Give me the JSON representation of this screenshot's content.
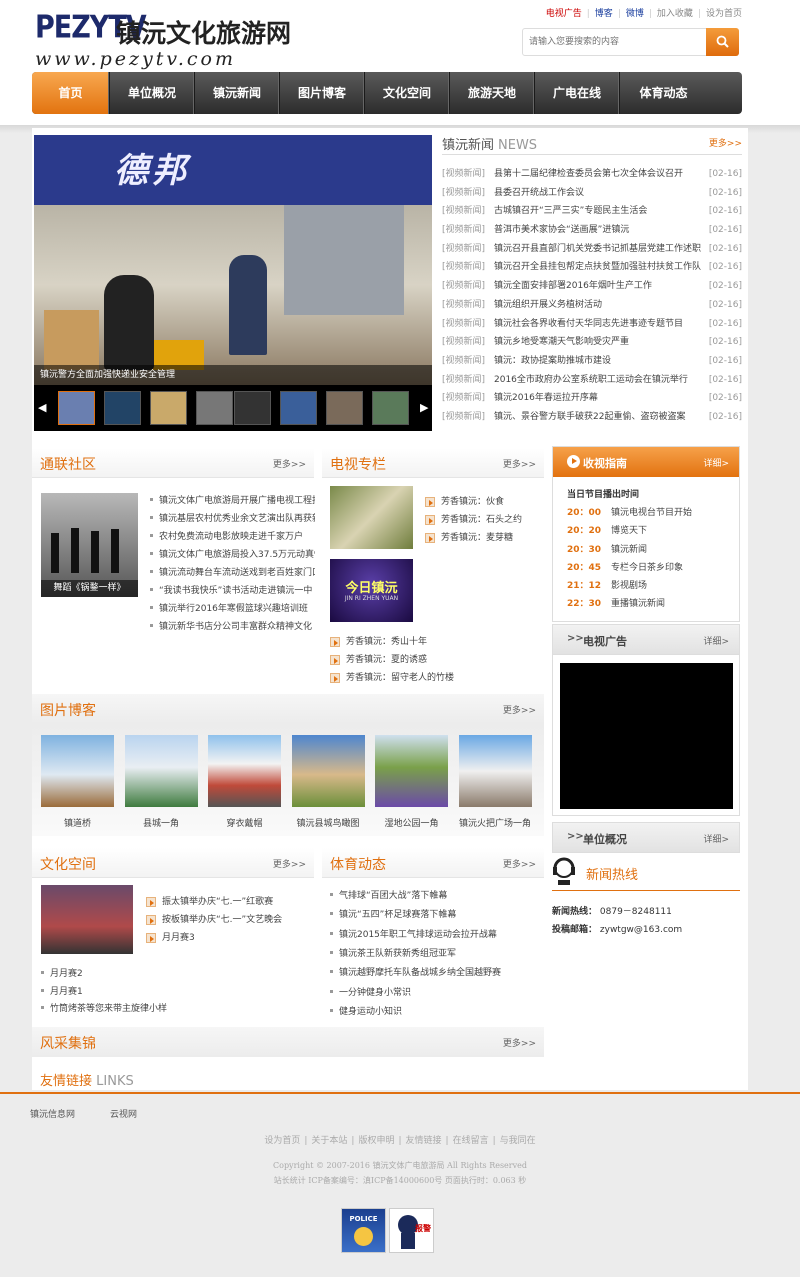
{
  "header": {
    "logo_en": "PEZYTV",
    "logo_cn": "镇沅文化旅游网",
    "logo_url": "www.pezytv.com",
    "links": [
      "电视广告",
      "博客",
      "微博",
      "加入收藏",
      "设为首页"
    ],
    "search_placeholder": "请输入您要搜索的内容"
  },
  "nav": [
    "首页",
    "单位概况",
    "镇沅新闻",
    "图片博客",
    "文化空间",
    "旅游天地",
    "广电在线",
    "体育动态"
  ],
  "slider": {
    "sign_text": "德邦",
    "caption": "镇沅警方全面加强快递业安全管理"
  },
  "news": {
    "title": "镇沅新闻",
    "title_en": "NEWS",
    "more": "更多>>",
    "items": [
      {
        "tag": "[视频新闻]",
        "text": "县第十二届纪律检查委员会第七次全体会议召开",
        "date": "[02-16]"
      },
      {
        "tag": "[视频新闻]",
        "text": "县委召开统战工作会议",
        "date": "[02-16]"
      },
      {
        "tag": "[视频新闻]",
        "text": "古城镇召开“三严三实”专题民主生活会",
        "date": "[02-16]"
      },
      {
        "tag": "[视频新闻]",
        "text": "普洱市美术家协会“送画展”进镇沅",
        "date": "[02-16]"
      },
      {
        "tag": "[视频新闻]",
        "text": "镇沅召开县直部门机关党委书记抓基层党建工作述职",
        "date": "[02-16]"
      },
      {
        "tag": "[视频新闻]",
        "text": "镇沅召开全县挂包帮定点扶贫暨加强驻村扶贫工作队",
        "date": "[02-16]"
      },
      {
        "tag": "[视频新闻]",
        "text": "镇沅全面安排部署2016年烟叶生产工作",
        "date": "[02-16]"
      },
      {
        "tag": "[视频新闻]",
        "text": "镇沅组织开展义务植树活动",
        "date": "[02-16]"
      },
      {
        "tag": "[视频新闻]",
        "text": "镇沅社会各界收看付天华同志先进事迹专题节目",
        "date": "[02-16]"
      },
      {
        "tag": "[视频新闻]",
        "text": "镇沅乡地受寒潮天气影响受灾严重",
        "date": "[02-16]"
      },
      {
        "tag": "[视频新闻]",
        "text": "镇沅：政协提案助推城市建设",
        "date": "[02-16]"
      },
      {
        "tag": "[视频新闻]",
        "text": "2016全市政府办公室系统职工运动会在镇沅举行",
        "date": "[02-16]"
      },
      {
        "tag": "[视频新闻]",
        "text": "镇沅2016年春运拉开序幕",
        "date": "[02-16]"
      },
      {
        "tag": "[视频新闻]",
        "text": "镇沅、景谷警方联手破获22起重偷、盗窃被盗案",
        "date": "[02-16]"
      }
    ]
  },
  "tonglian": {
    "title": "通联社区",
    "more": "更多>>",
    "img_caption": "舞蹈《锅鍪一样》",
    "items": [
      "镇沅文体广电旅游局开展广播电视工程技",
      "镇沅基层农村优秀业余文艺演出队再获新",
      "农村免费流动电影放映走进千家万户",
      "镇沅文体广电旅游局投入37.5万元动真情",
      "镇沅流动舞台车流动送戏到老百姓家门口",
      "“我读书我快乐”读书活动走进镇沅一中",
      "镇沅举行2016年寒假篮球兴趣培训班",
      "镇沅新华书店分公司丰富群众精神文化"
    ]
  },
  "tv": {
    "title": "电视专栏",
    "more": "更多>>",
    "logo_text": "今日镇沅",
    "logo_sub": "JIN RI ZHEN YUAN",
    "items_a": [
      "芳香镇沅：伙食",
      "芳香镇沅：石头之约",
      "芳香镇沅：麦芽糖"
    ],
    "items_b": [
      "芳香镇沅：秀山十年",
      "芳香镇沅：夏的诱惑",
      "芳香镇沅：留守老人的竹楼"
    ]
  },
  "guide": {
    "title": "收视指南",
    "more": "详细>",
    "subtitle": "当日节目播出时间",
    "rows": [
      {
        "time": "20：00",
        "name": "镇沅电视台节目开始"
      },
      {
        "time": "20：20",
        "name": "博览天下"
      },
      {
        "time": "20：30",
        "name": "镇沅新闻"
      },
      {
        "time": "20：45",
        "name": "专栏今日茶乡印象"
      },
      {
        "time": "21：12",
        "name": "影视剧场"
      },
      {
        "time": "22：30",
        "name": "重播镇沅新闻"
      }
    ]
  },
  "tvad": {
    "title": "电视广告",
    "more": "详细>",
    "arrows": ">>"
  },
  "unit": {
    "title": "单位概况",
    "more": "详细>",
    "arrows": ">>"
  },
  "hotline": {
    "title": "新闻热线",
    "phone_label": "新闻热线：",
    "phone": "0879－8248111",
    "mail_label": "投稿邮箱：",
    "mail": "zywtgw@163.com"
  },
  "photos": {
    "title": "图片博客",
    "more": "更多>>",
    "items": [
      "镇道桥",
      "县城一角",
      "穿衣戴帽",
      "镇沅县城鸟瞰图",
      "湿地公园一角",
      "镇沅火把广场一角"
    ]
  },
  "culture": {
    "title": "文化空间",
    "more": "更多>>",
    "items_a": [
      "振太镇举办庆“七.一”红歌赛",
      "按板镇举办庆“七.一”文艺晚会",
      "月月赛3"
    ],
    "items_b": [
      "月月赛2",
      "月月赛1",
      "竹筒烤茶等您来带主旋律小样"
    ]
  },
  "sport": {
    "title": "体育动态",
    "more": "更多>>",
    "items": [
      "气排球“百团大战”落下帷幕",
      "镇沅“五四”杯足球赛落下帷幕",
      "镇沅2015年职工气排球运动会拉开战幕",
      "镇沅茶王队新获新秀组冠亚军",
      "镇沅越野摩托车队备战城乡纳全国越野赛",
      "一分钟健身小常识",
      "健身运动小知识"
    ]
  },
  "fengcai": {
    "title": "风采集锦",
    "more": "更多>>"
  },
  "links": {
    "title": "友情链接",
    "title_en": "LINKS"
  },
  "footer": {
    "links": [
      "镇沅信息网",
      "云视网"
    ],
    "nav": [
      "设为首页",
      "关于本站",
      "版权申明",
      "友情链接",
      "在线留言",
      "与我同在"
    ],
    "copy1": "Copyright © 2007-2016 镇沅文体广电旅游局 All Rights Reserved",
    "copy2": "站长统计  ICP备案编号：滇ICP备14000600号 页面执行时：0.063 秒",
    "badge1": "POLICE",
    "badge2": "报警"
  }
}
